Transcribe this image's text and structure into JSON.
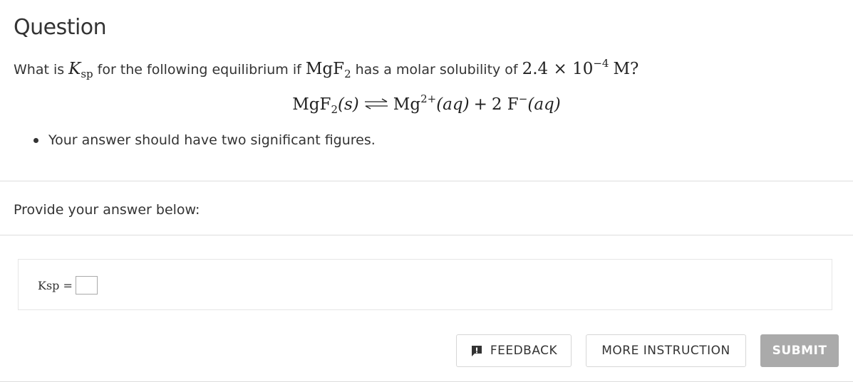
{
  "heading": "Question",
  "question": {
    "prefix": "What is",
    "k_symbol": "K",
    "k_sub": "sp",
    "middle": "for the following equilibrium if",
    "compound": "MgF",
    "compound_sub": "2",
    "suffix": "has a molar solubility of",
    "value": "2.4 × 10",
    "exponent": "−4",
    "unit": "M?"
  },
  "equation": {
    "reactant": "MgF",
    "reactant_sub": "2",
    "reactant_phase": "(s)",
    "product1": "Mg",
    "product1_charge": "2+",
    "product1_phase": "(aq)",
    "plus": "+",
    "product2": "2 F",
    "product2_charge": "−",
    "product2_phase": "(aq)"
  },
  "bullet": "Your answer should have two significant figures.",
  "provide_label": "Provide your answer below:",
  "answer": {
    "label": "Ksp =",
    "value": ""
  },
  "buttons": {
    "feedback": "FEEDBACK",
    "more": "MORE INSTRUCTION",
    "submit": "SUBMIT"
  },
  "colors": {
    "text": "#333333",
    "divider": "#dddddd",
    "submit_bg": "#aaaaaa"
  }
}
